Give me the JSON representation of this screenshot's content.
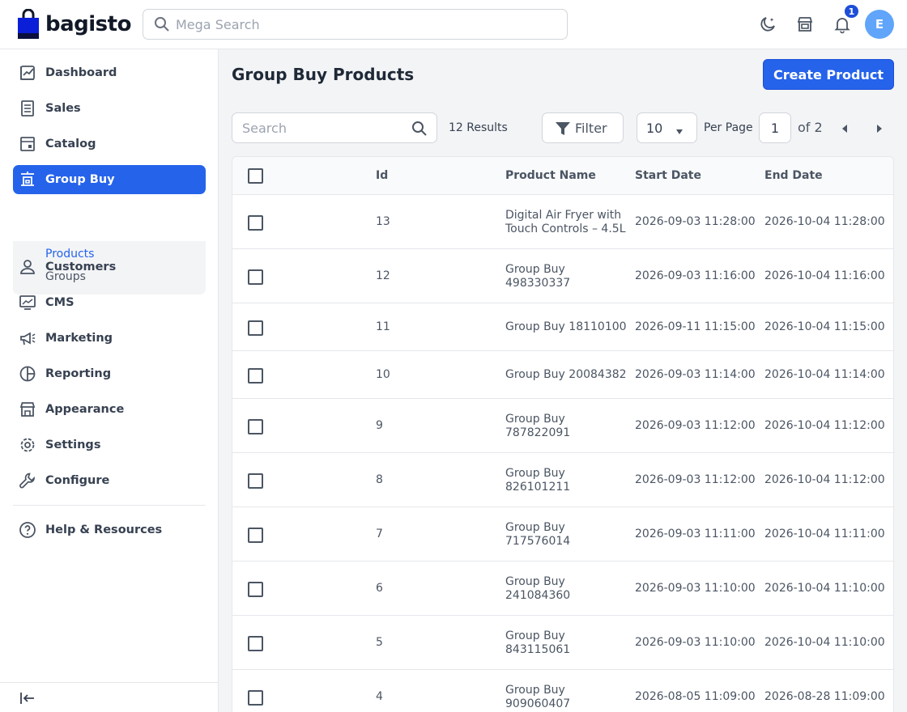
{
  "app": {
    "brand": "bagisto"
  },
  "header": {
    "search_placeholder": "Mega Search",
    "notification_count": "1",
    "avatar_initial": "E"
  },
  "sidebar": {
    "items": [
      {
        "label": "Dashboard",
        "icon": "dashboard-icon"
      },
      {
        "label": "Sales",
        "icon": "sales-icon"
      },
      {
        "label": "Catalog",
        "icon": "catalog-icon"
      },
      {
        "label": "Group Buy",
        "icon": "group-buy-icon"
      },
      {
        "label": "Customers",
        "icon": "customers-icon"
      },
      {
        "label": "CMS",
        "icon": "cms-icon"
      },
      {
        "label": "Marketing",
        "icon": "marketing-icon"
      },
      {
        "label": "Reporting",
        "icon": "reporting-icon"
      },
      {
        "label": "Appearance",
        "icon": "appearance-icon"
      },
      {
        "label": "Settings",
        "icon": "settings-icon"
      },
      {
        "label": "Configure",
        "icon": "configure-icon"
      },
      {
        "label": "Help & Resources",
        "icon": "help-icon"
      }
    ],
    "group_buy_sub": [
      "Products",
      "Groups"
    ]
  },
  "main": {
    "title": "Group Buy Products",
    "create_label": "Create Product",
    "search_placeholder": "Search",
    "results": "12 Results",
    "filter_label": "Filter",
    "per_page_value": "10",
    "per_page_label": "Per Page",
    "page_value": "1",
    "page_of": "of 2"
  },
  "table": {
    "columns": [
      "Id",
      "Product Name",
      "Start Date",
      "End Date"
    ],
    "rows": [
      {
        "id": "13",
        "name": [
          "Digital Air Fryer with",
          "Touch Controls – 4.5L"
        ],
        "start": "2026-09-03 11:28:00",
        "end": "2026-10-04 11:28:00"
      },
      {
        "id": "12",
        "name": [
          "Group Buy",
          "498330337"
        ],
        "start": "2026-09-03 11:16:00",
        "end": "2026-10-04 11:16:00"
      },
      {
        "id": "11",
        "name": [
          "Group Buy 18110100"
        ],
        "start": "2026-09-11 11:15:00",
        "end": "2026-10-04 11:15:00"
      },
      {
        "id": "10",
        "name": [
          "Group Buy 20084382"
        ],
        "start": "2026-09-03 11:14:00",
        "end": "2026-10-04 11:14:00"
      },
      {
        "id": "9",
        "name": [
          "Group Buy",
          "787822091"
        ],
        "start": "2026-09-03 11:12:00",
        "end": "2026-10-04 11:12:00"
      },
      {
        "id": "8",
        "name": [
          "Group Buy",
          "826101211"
        ],
        "start": "2026-09-03 11:12:00",
        "end": "2026-10-04 11:12:00"
      },
      {
        "id": "7",
        "name": [
          "Group Buy",
          "717576014"
        ],
        "start": "2026-09-03 11:11:00",
        "end": "2026-10-04 11:11:00"
      },
      {
        "id": "6",
        "name": [
          "Group Buy",
          "241084360"
        ],
        "start": "2026-09-03 11:10:00",
        "end": "2026-10-04 11:10:00"
      },
      {
        "id": "5",
        "name": [
          "Group Buy",
          "843115061"
        ],
        "start": "2026-09-03 11:10:00",
        "end": "2026-10-04 11:10:00"
      },
      {
        "id": "4",
        "name": [
          "Group Buy",
          "909060407"
        ],
        "start": "2026-08-05 11:09:00",
        "end": "2026-08-28 11:09:00"
      }
    ]
  },
  "colors": {
    "accent": "#2563eb",
    "avatar": "#60a5fa"
  }
}
